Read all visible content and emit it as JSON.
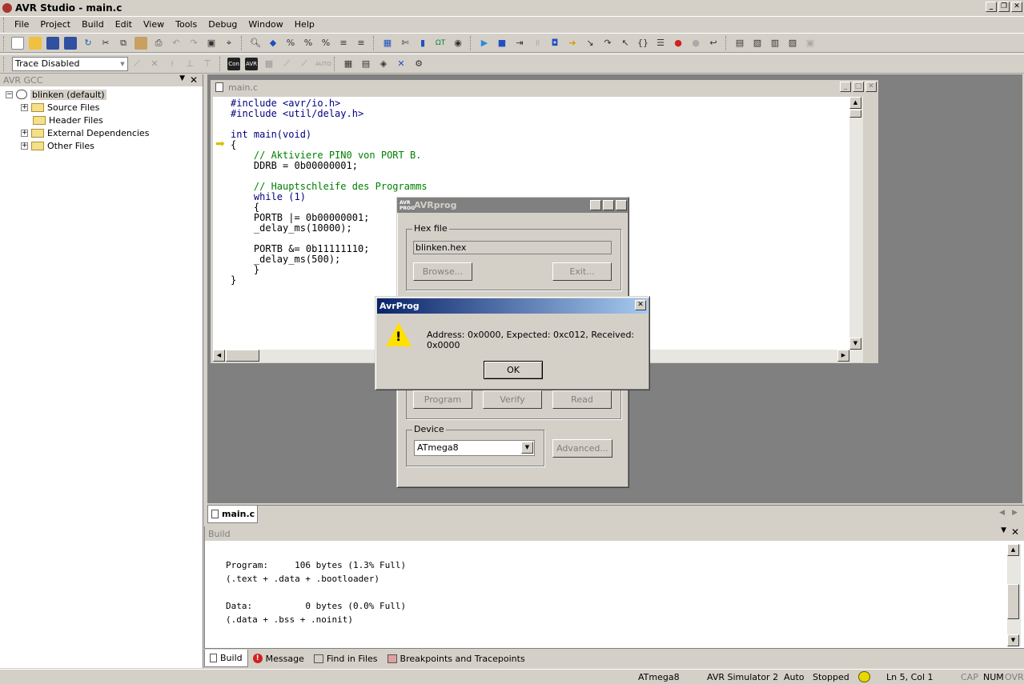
{
  "app": {
    "title": "AVR Studio - main.c"
  },
  "menu": [
    "File",
    "Project",
    "Build",
    "Edit",
    "View",
    "Tools",
    "Debug",
    "Window",
    "Help"
  ],
  "toolbar2": {
    "trace_combo": "Trace Disabled"
  },
  "sidebar": {
    "header": "AVR GCC",
    "project": "blinken (default)",
    "items": [
      "Source Files",
      "Header Files",
      "External Dependencies",
      "Other Files"
    ]
  },
  "editor": {
    "title": "main.c",
    "code": [
      {
        "t": "#include <avr/io.h>",
        "c": "kw"
      },
      {
        "t": "#include <util/delay.h>",
        "c": "kw"
      },
      {
        "t": "",
        "c": ""
      },
      {
        "t": "int main(void)",
        "c": "kw"
      },
      {
        "t": "{",
        "c": ""
      },
      {
        "t": "    // Aktiviere PIN0 von PORT B.",
        "c": "cm"
      },
      {
        "t": "    DDRB = 0b00000001;",
        "c": ""
      },
      {
        "t": "",
        "c": ""
      },
      {
        "t": "    // Hauptschleife des Programms",
        "c": "cm"
      },
      {
        "t": "    while (1)",
        "c": "kw"
      },
      {
        "t": "    {",
        "c": ""
      },
      {
        "t": "    PORTB |= 0b00000001;",
        "c": ""
      },
      {
        "t": "    _delay_ms(10000);",
        "c": ""
      },
      {
        "t": "",
        "c": ""
      },
      {
        "t": "    PORTB &= 0b11111110;",
        "c": ""
      },
      {
        "t": "    _delay_ms(500);",
        "c": ""
      },
      {
        "t": "    }",
        "c": ""
      },
      {
        "t": "}",
        "c": ""
      }
    ]
  },
  "avrprog": {
    "title": "AVRprog",
    "hex_group": "Hex file",
    "hex_value": "blinken.hex",
    "browse": "Browse...",
    "exit": "Exit...",
    "program": "Program",
    "verify": "Verify",
    "read": "Read",
    "device_group": "Device",
    "device_value": "ATmega8",
    "advanced": "Advanced..."
  },
  "alert": {
    "title": "AvrProg",
    "message": "Address: 0x0000, Expected: 0xc012, Received: 0x0000",
    "ok": "OK"
  },
  "doctab": {
    "label": "main.c"
  },
  "build": {
    "header": "Build",
    "lines": [
      "Program:     106 bytes (1.3% Full)",
      "(.text + .data + .bootloader)",
      "",
      "Data:          0 bytes (0.0% Full)",
      "(.data + .bss + .noinit)"
    ],
    "tabs": [
      "Build",
      "Message",
      "Find in Files",
      "Breakpoints and Tracepoints"
    ]
  },
  "status": {
    "device": "ATmega8",
    "platform": "AVR Simulator 2",
    "mode": "Auto",
    "state": "Stopped",
    "position": "Ln 5, Col 1",
    "cap": "CAP",
    "num": "NUM",
    "ovr": "OVR"
  }
}
